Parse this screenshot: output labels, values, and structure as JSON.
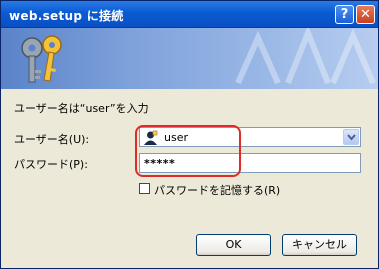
{
  "window": {
    "title": "web.setup に接続",
    "help_button": "?",
    "close_button": "✕"
  },
  "dialog": {
    "prompt": "ユーザー名は“user”を入力",
    "username_label": "ユーザー名(U):",
    "username_value": "user",
    "password_label": "パスワード(P):",
    "password_value": "*****",
    "remember_label": "パスワードを記憶する(R)",
    "remember_checked": false
  },
  "buttons": {
    "ok": "OK",
    "cancel": "キャンセル"
  },
  "icons": {
    "keys": "keys-icon",
    "user_avatar": "user-avatar-icon",
    "dropdown": "chevron-down-icon"
  },
  "colors": {
    "titlebar": "#0a5bd3",
    "window_bg": "#ece9d8",
    "highlight": "#e02a2a"
  }
}
